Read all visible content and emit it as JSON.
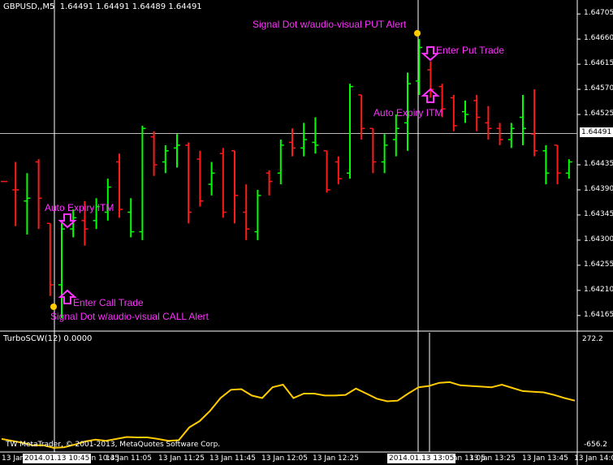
{
  "header": {
    "symbol_timeframe": "GBPUSD,,M5",
    "ohlc": "1.64491 1.64491 1.64489 1.64491"
  },
  "indicator": {
    "label": "TurboSCW(12) 0.0000",
    "scale_max": "272.2",
    "scale_min": "-656.2"
  },
  "copyright": "TW MetaTrader, © 2001-2013, MetaQuotes Software Corp.",
  "price_scale": [
    "1.64705",
    "1.64660",
    "1.64615",
    "1.64570",
    "1.64525",
    "1.64435",
    "1.64390",
    "1.64345",
    "1.64300",
    "1.64255",
    "1.64210",
    "1.64165"
  ],
  "current_price": "1.64491",
  "time_scale": [
    "13 Jan",
    "13 Jan 10:45",
    "13 Jan 11:05",
    "13 Jan 11:25",
    "13 Jan 11:45",
    "13 Jan 12:05",
    "13 Jan 12:25",
    "13 Jan 13:05",
    "13 Jan 13:25",
    "13 Jan 13:45",
    "13 Jan 14:05"
  ],
  "crosshair_labels": {
    "left": "2014.01.13 10:45",
    "right": "2014.01.13 13:05"
  },
  "annotations": {
    "put_signal": "Signal Dot w/audio-visual PUT Alert",
    "enter_put": "Enter Put Trade",
    "auto_expiry_top": "Auto Expiry ITM",
    "auto_expiry_bottom": "Auto Expiry ITM",
    "enter_call": "Enter Call Trade",
    "call_signal": "Signal Dot w/audio-visual CALL Alert"
  },
  "colors": {
    "background": "#000000",
    "bull_bar": "#00ff00",
    "bear_bar": "#ff1a1a",
    "indicator_line": "#ffcc00",
    "annotation": "#ff33ff",
    "signal_dot": "#ffcc00",
    "crosshair": "#ffffff"
  },
  "chart_data": {
    "type": "ohlc",
    "bars": [
      {
        "o": 1.64405,
        "h": 1.64405,
        "l": 1.64405,
        "c": 1.64405,
        "bull": false
      },
      {
        "o": 1.6439,
        "h": 1.6444,
        "l": 1.64325,
        "c": 1.6439,
        "bull": false
      },
      {
        "o": 1.6437,
        "h": 1.6442,
        "l": 1.6431,
        "c": 1.64375,
        "bull": true
      },
      {
        "o": 1.6444,
        "h": 1.64445,
        "l": 1.6432,
        "c": 1.64375,
        "bull": false
      },
      {
        "o": 1.6433,
        "h": 1.6433,
        "l": 1.642,
        "c": 1.6422,
        "bull": false
      },
      {
        "o": 1.6422,
        "h": 1.6433,
        "l": 1.6416,
        "c": 1.6432,
        "bull": true
      },
      {
        "o": 1.6432,
        "h": 1.64355,
        "l": 1.64305,
        "c": 1.6434,
        "bull": true
      },
      {
        "o": 1.64335,
        "h": 1.6437,
        "l": 1.6429,
        "c": 1.6432,
        "bull": false
      },
      {
        "o": 1.64335,
        "h": 1.64375,
        "l": 1.6432,
        "c": 1.6436,
        "bull": true
      },
      {
        "o": 1.6435,
        "h": 1.6441,
        "l": 1.64335,
        "c": 1.64395,
        "bull": true
      },
      {
        "o": 1.6444,
        "h": 1.64455,
        "l": 1.6434,
        "c": 1.64355,
        "bull": false
      },
      {
        "o": 1.6435,
        "h": 1.64375,
        "l": 1.64305,
        "c": 1.64315,
        "bull": true
      },
      {
        "o": 1.64315,
        "h": 1.64505,
        "l": 1.643,
        "c": 1.645,
        "bull": true
      },
      {
        "o": 1.64485,
        "h": 1.64495,
        "l": 1.64415,
        "c": 1.64435,
        "bull": false
      },
      {
        "o": 1.6444,
        "h": 1.6447,
        "l": 1.6442,
        "c": 1.6446,
        "bull": true
      },
      {
        "o": 1.64465,
        "h": 1.6449,
        "l": 1.6443,
        "c": 1.6447,
        "bull": true
      },
      {
        "o": 1.6447,
        "h": 1.64475,
        "l": 1.6433,
        "c": 1.6435,
        "bull": false
      },
      {
        "o": 1.64445,
        "h": 1.6446,
        "l": 1.6436,
        "c": 1.6437,
        "bull": false
      },
      {
        "o": 1.644,
        "h": 1.6444,
        "l": 1.6438,
        "c": 1.6442,
        "bull": true
      },
      {
        "o": 1.64455,
        "h": 1.64465,
        "l": 1.6434,
        "c": 1.6435,
        "bull": false
      },
      {
        "o": 1.6446,
        "h": 1.6446,
        "l": 1.6433,
        "c": 1.6438,
        "bull": false
      },
      {
        "o": 1.6435,
        "h": 1.644,
        "l": 1.643,
        "c": 1.6432,
        "bull": false
      },
      {
        "o": 1.64315,
        "h": 1.6439,
        "l": 1.643,
        "c": 1.6438,
        "bull": true
      },
      {
        "o": 1.6442,
        "h": 1.64425,
        "l": 1.6438,
        "c": 1.64405,
        "bull": false
      },
      {
        "o": 1.6442,
        "h": 1.6448,
        "l": 1.644,
        "c": 1.6447,
        "bull": true
      },
      {
        "o": 1.64475,
        "h": 1.645,
        "l": 1.6445,
        "c": 1.64465,
        "bull": false
      },
      {
        "o": 1.64465,
        "h": 1.6451,
        "l": 1.6445,
        "c": 1.6448,
        "bull": true
      },
      {
        "o": 1.64475,
        "h": 1.6452,
        "l": 1.64455,
        "c": 1.6447,
        "bull": true
      },
      {
        "o": 1.6446,
        "h": 1.6446,
        "l": 1.64385,
        "c": 1.6439,
        "bull": false
      },
      {
        "o": 1.6444,
        "h": 1.6445,
        "l": 1.644,
        "c": 1.6441,
        "bull": false
      },
      {
        "o": 1.6442,
        "h": 1.6458,
        "l": 1.6441,
        "c": 1.64575,
        "bull": true
      },
      {
        "o": 1.6456,
        "h": 1.6456,
        "l": 1.6448,
        "c": 1.645,
        "bull": false
      },
      {
        "o": 1.645,
        "h": 1.645,
        "l": 1.6442,
        "c": 1.6444,
        "bull": false
      },
      {
        "o": 1.6444,
        "h": 1.6449,
        "l": 1.6442,
        "c": 1.6447,
        "bull": true
      },
      {
        "o": 1.6448,
        "h": 1.64525,
        "l": 1.6445,
        "c": 1.645,
        "bull": true
      },
      {
        "o": 1.6451,
        "h": 1.646,
        "l": 1.6446,
        "c": 1.6458,
        "bull": true
      },
      {
        "o": 1.64585,
        "h": 1.6466,
        "l": 1.6456,
        "c": 1.64645,
        "bull": true
      },
      {
        "o": 1.64605,
        "h": 1.6462,
        "l": 1.64555,
        "c": 1.6457,
        "bull": false
      },
      {
        "o": 1.64575,
        "h": 1.6458,
        "l": 1.6452,
        "c": 1.64535,
        "bull": false
      },
      {
        "o": 1.64555,
        "h": 1.6456,
        "l": 1.64495,
        "c": 1.64505,
        "bull": false
      },
      {
        "o": 1.6453,
        "h": 1.6455,
        "l": 1.6451,
        "c": 1.64525,
        "bull": true
      },
      {
        "o": 1.6455,
        "h": 1.6456,
        "l": 1.64495,
        "c": 1.6452,
        "bull": false
      },
      {
        "o": 1.6451,
        "h": 1.6454,
        "l": 1.6448,
        "c": 1.645,
        "bull": false
      },
      {
        "o": 1.645,
        "h": 1.6451,
        "l": 1.6447,
        "c": 1.6448,
        "bull": false
      },
      {
        "o": 1.6448,
        "h": 1.6451,
        "l": 1.64465,
        "c": 1.645,
        "bull": true
      },
      {
        "o": 1.6452,
        "h": 1.6456,
        "l": 1.6447,
        "c": 1.645,
        "bull": true
      },
      {
        "o": 1.6449,
        "h": 1.6457,
        "l": 1.6445,
        "c": 1.6446,
        "bull": false
      },
      {
        "o": 1.6446,
        "h": 1.6447,
        "l": 1.644,
        "c": 1.6442,
        "bull": true
      },
      {
        "o": 1.6447,
        "h": 1.6447,
        "l": 1.644,
        "c": 1.6442,
        "bull": false
      },
      {
        "o": 1.6442,
        "h": 1.64445,
        "l": 1.6441,
        "c": 1.6444,
        "bull": true
      }
    ],
    "signals": [
      {
        "type": "put",
        "bar": 36,
        "price": 1.6465
      },
      {
        "type": "call",
        "bar": 4,
        "price": 1.64178
      }
    ],
    "indicator_series": [
      -560,
      -575,
      -590,
      -610,
      -610,
      -630,
      -625,
      -605,
      -580,
      -565,
      -575,
      -560,
      -545,
      -548,
      -548,
      -560,
      -575,
      -570,
      -470,
      -420,
      -340,
      -240,
      -175,
      -170,
      -220,
      -240,
      -155,
      -135,
      -240,
      -205,
      -205,
      -220,
      -220,
      -215,
      -165,
      -205,
      -245,
      -265,
      -260,
      -205,
      -155,
      -145,
      -120,
      -115,
      -140,
      -145,
      -150,
      -155,
      -135,
      -160,
      -185,
      -190,
      -195,
      -215,
      -240,
      -260
    ]
  }
}
